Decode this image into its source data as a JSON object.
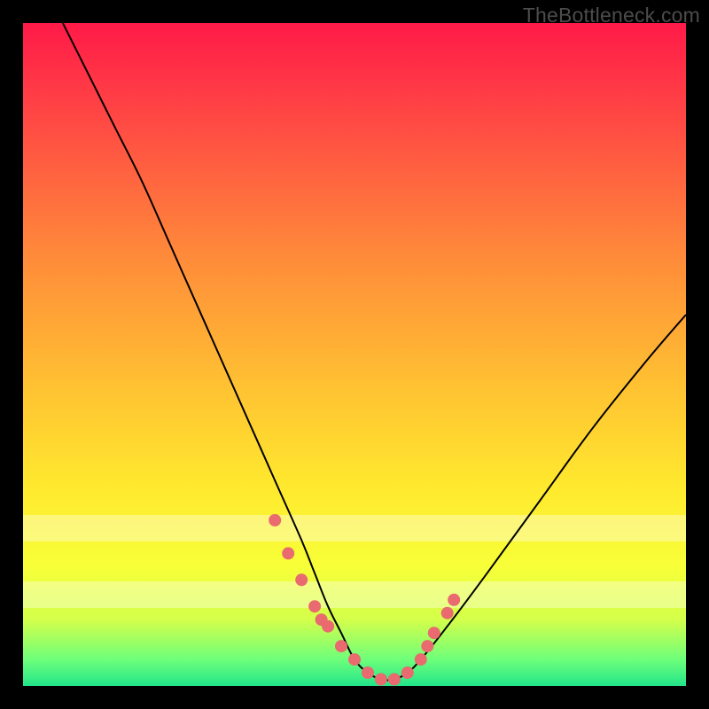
{
  "watermark": "TheBottleneck.com",
  "chart_data": {
    "type": "line",
    "title": "",
    "xlabel": "",
    "ylabel": "",
    "xlim": [
      0,
      100
    ],
    "ylim": [
      0,
      100
    ],
    "series": [
      {
        "name": "bottleneck-curve",
        "x": [
          6,
          10,
          14,
          18,
          22,
          26,
          30,
          34,
          38,
          42,
          44,
          46,
          48,
          50,
          52,
          54,
          56,
          58,
          60,
          64,
          70,
          78,
          86,
          94,
          100
        ],
        "y": [
          100,
          92,
          84,
          76,
          67,
          58,
          49,
          40,
          31,
          22,
          17,
          12,
          8,
          4,
          2,
          1,
          1,
          2,
          4,
          9,
          17,
          28,
          39,
          49,
          56
        ]
      }
    ],
    "markers": {
      "name": "highlight-dots",
      "x": [
        38,
        40,
        42,
        44,
        45,
        46,
        48,
        50,
        52,
        54,
        56,
        58,
        60,
        61,
        62,
        64,
        65
      ],
      "y": [
        25,
        20,
        16,
        12,
        10,
        9,
        6,
        4,
        2,
        1,
        1,
        2,
        4,
        6,
        8,
        11,
        13
      ]
    },
    "bands": [
      {
        "name": "pale-band-1",
        "y0": 74,
        "y1": 78
      },
      {
        "name": "pale-band-2",
        "y0": 84,
        "y1": 88
      }
    ]
  }
}
